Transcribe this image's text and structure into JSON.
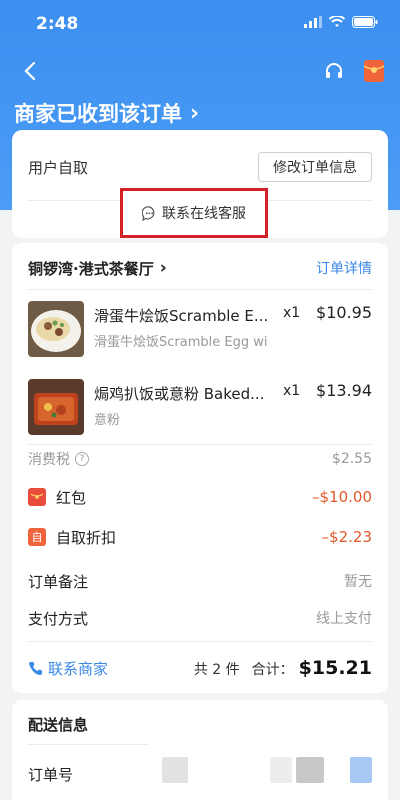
{
  "status_bar": {
    "time": "2:48"
  },
  "header": {
    "title": "商家已收到该订单",
    "title_chevron": "›"
  },
  "pickup": {
    "label": "用户自取",
    "modify_button": "修改订单信息"
  },
  "customer_service": {
    "label": "联系在线客服"
  },
  "store": {
    "name": "铜锣湾·港式茶餐厅",
    "chevron": "›",
    "detail_link": "订单详情"
  },
  "items": [
    {
      "name": "滑蛋牛烩饭Scramble E...",
      "sub": "滑蛋牛烩饭Scramble Egg wi",
      "qty": "x1",
      "price": "$10.95"
    },
    {
      "name": "焗鸡扒饭或意粉 Baked...",
      "sub": "意粉",
      "qty": "x1",
      "price": "$13.94"
    }
  ],
  "fees": {
    "tax_label": "消费税",
    "tax_value": "$2.55",
    "red_packet_label": "红包",
    "red_packet_value": "–$10.00",
    "pickup_discount_icon": "自",
    "pickup_discount_label": "自取折扣",
    "pickup_discount_value": "–$2.23"
  },
  "remarks": {
    "label": "订单备注",
    "value": "暂无"
  },
  "payment": {
    "label": "支付方式",
    "value": "线上支付"
  },
  "summary": {
    "contact_merchant": "联系商家",
    "count": "共 2 件",
    "total_label": "合计：",
    "total_value": "$15.21"
  },
  "delivery": {
    "title": "配送信息",
    "order_no_label": "订单号"
  },
  "colors": {
    "primary_blue": "#3d8ff0",
    "link_blue": "#3b89e6",
    "discount_orange": "#e4582a",
    "highlight_red": "#d42027"
  }
}
